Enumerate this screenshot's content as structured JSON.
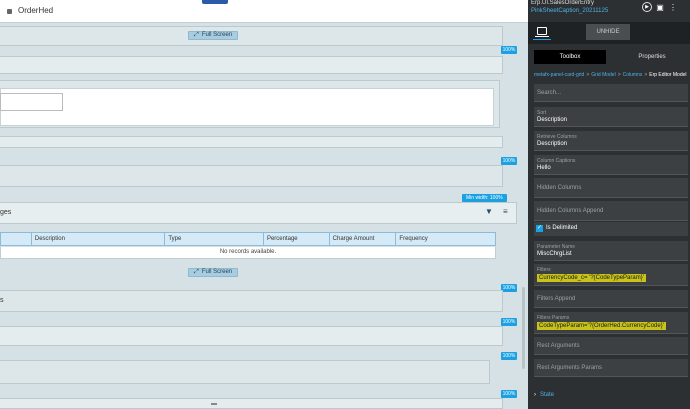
{
  "canvas": {
    "tab_label": "OrderHed",
    "full_screen_label": "Full Screen",
    "percent_badge": "100%",
    "min_width_badge": "Min width: 100%",
    "grid_tab_label_1": "ges",
    "grid_tab_label_2": "s",
    "grid_columns": [
      "",
      "Description",
      "Type",
      "Percentage",
      "Charge Amount",
      "Frequency"
    ],
    "no_records": "No records available."
  },
  "panel": {
    "title": "Erp.UI.SalesOrderEntry",
    "subtitle": "PinkSheetCaption_20211125",
    "unhide_label": "UNHIDE",
    "tabs": {
      "toolbox": "Toolbox",
      "properties": "Properties"
    },
    "breadcrumb": [
      "metafx-panel-card-grid",
      "Grid Model",
      "Columns",
      "Erp Editor Model"
    ],
    "search_placeholder": "Search...",
    "fields": {
      "sort": {
        "label": "Sort",
        "value": "Description"
      },
      "retrieve_columns": {
        "label": "Retrieve Columns",
        "value": "Description"
      },
      "column_captions": {
        "label": "Column Captions",
        "value": "Hello"
      },
      "hidden_columns": {
        "label": "Hidden Columns"
      },
      "hidden_columns_append": {
        "label": "Hidden Columns Append"
      },
      "is_delimited": {
        "label": "Is Delimited",
        "checked": true
      },
      "parameter_name": {
        "label": "Parameter Name",
        "value": "MiscChrgList"
      },
      "filters": {
        "label": "Filters",
        "value": "CurrencyCode_c= '?{CodeTypeParam}'"
      },
      "filters_append": {
        "label": "Filters Append"
      },
      "filters_params": {
        "label": "Filters Params",
        "value": "CodeTypeParam='?{OrderHed.CurrencyCode}'"
      },
      "rest_arguments": {
        "label": "Rest Arguments"
      },
      "rest_arguments_params": {
        "label": "Rest Arguments Params"
      }
    },
    "state_label": "State"
  },
  "icons": {
    "laptop": "laptop-icon",
    "play": "play-icon",
    "save": "save-icon",
    "more": "more-icon",
    "filter": "filter-icon",
    "menu": "menu-icon",
    "expand": "expand-icon",
    "chevron": "chevron-right-icon"
  },
  "colors": {
    "accent": "#1ba1e2",
    "panel_bg": "#2d3032",
    "highlight": "#c8c31a",
    "grid_header": "#d5eaf6"
  }
}
